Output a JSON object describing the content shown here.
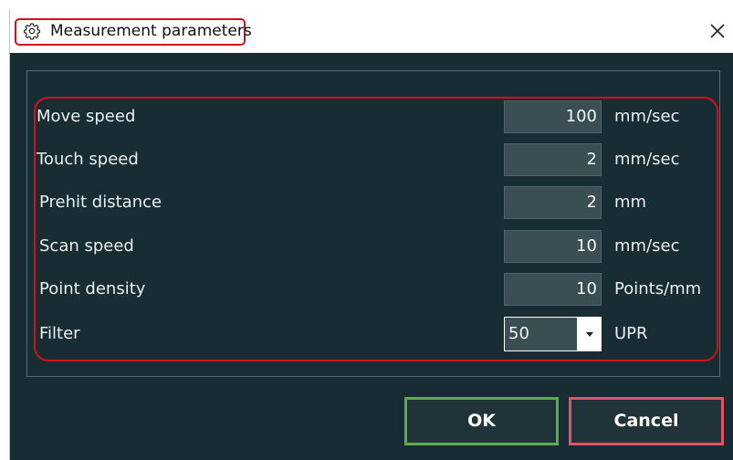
{
  "dialog": {
    "title": "Measurement parameters",
    "title_icon": "gear-icon",
    "close_icon": "close-icon"
  },
  "params": [
    {
      "label": "Move speed",
      "value": "100",
      "unit": "mm/sec"
    },
    {
      "label": "Touch speed",
      "value": "2",
      "unit": "mm/sec"
    },
    {
      "label": "Prehit distance",
      "value": "2",
      "unit": "mm"
    },
    {
      "label": "Scan speed",
      "value": "10",
      "unit": "mm/sec"
    },
    {
      "label": "Point density",
      "value": "10",
      "unit": "Points/mm"
    }
  ],
  "filter": {
    "label": "Filter",
    "value": "50",
    "unit": "UPR"
  },
  "buttons": {
    "ok": "OK",
    "cancel": "Cancel"
  },
  "colors": {
    "background": "#172d33",
    "field": "#3a4e54",
    "highlight": "#d4111b",
    "ok_border": "#5cab4e",
    "cancel_border": "#e15461"
  }
}
